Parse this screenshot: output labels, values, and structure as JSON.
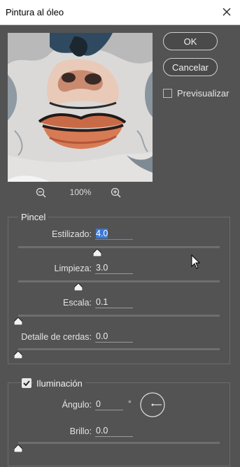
{
  "dialog": {
    "title": "Pintura al óleo"
  },
  "buttons": {
    "ok_label": "OK",
    "cancel_label": "Cancelar"
  },
  "preview_option": {
    "label": "Previsualizar",
    "checked": false
  },
  "zoom": {
    "level": "100%"
  },
  "pincel": {
    "legend": "Pincel",
    "estilizado": {
      "label": "Estilizado:",
      "value": "4.0"
    },
    "limpieza": {
      "label": "Limpieza:",
      "value": "3.0"
    },
    "escala": {
      "label": "Escala:",
      "value": "0.1"
    },
    "detalle": {
      "label": "Detalle de cerdas:",
      "value": "0.0"
    }
  },
  "iluminacion": {
    "legend": "Iluminación",
    "checked": true,
    "angulo": {
      "label": "Ángulo:",
      "value": "0",
      "unit": "°"
    },
    "brillo": {
      "label": "Brillo:",
      "value": "0.0"
    }
  }
}
